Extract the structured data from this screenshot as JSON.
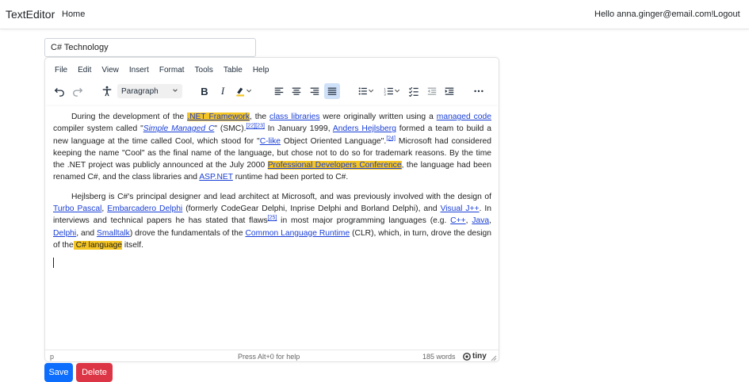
{
  "navbar": {
    "brand": "TextEditor",
    "home": "Home",
    "greeting": "Hello anna.ginger@email.com!",
    "logout": "Logout"
  },
  "document": {
    "title_value": "C# Technology"
  },
  "menubar": [
    "File",
    "Edit",
    "View",
    "Insert",
    "Format",
    "Tools",
    "Table",
    "Help"
  ],
  "toolbar": {
    "block_format": "Paragraph",
    "icons": [
      "undo-icon",
      "redo-icon",
      "accessibility-icon",
      "bold-icon",
      "italic-icon",
      "highlight-icon",
      "align-left-icon",
      "align-center-icon",
      "align-right-icon",
      "align-justify-icon",
      "bullet-list-icon",
      "numbered-list-icon",
      "checklist-icon",
      "outdent-icon",
      "indent-icon",
      "more-icon"
    ],
    "active_color": "#cfe1f8",
    "highlight_color": "#f5c523"
  },
  "content": {
    "p1": {
      "t1": "During the development of the ",
      "a1": ".NET Framework",
      "t2": ", the ",
      "a2": "class libraries",
      "t3": " were originally written using a ",
      "a3": "managed code",
      "t4": " compiler system called \"",
      "a4": "Simple Managed C",
      "t5": "\" (SMC).",
      "s1": "[22]",
      "s2": "[23]",
      "t6": " In January 1999, ",
      "a5": "Anders Hejlsberg",
      "t7": " formed a team to build a new language at the time called Cool, which stood for \"",
      "a6": "C-like",
      "t8": " Object Oriented Language\".",
      "s3": "[24]",
      "t9": " Microsoft had considered keeping the name \"Cool\" as the final name of the language, but chose not to do so for trademark reasons. By the time the .NET project was publicly announced at the July 2000 ",
      "a7": "Professional Developers Conference",
      "t10": ", the language had been renamed C#, and the class libraries and ",
      "a8": "ASP.NET",
      "t11": " runtime had been ported to C#."
    },
    "p2": {
      "t1": "Hejlsberg is C#'s principal designer and lead architect at Microsoft, and was previously involved with the design of ",
      "a1": "Turbo Pascal",
      "t2": ", ",
      "a2": "Embarcadero Delphi",
      "t3": " (formerly CodeGear Delphi, Inprise Delphi and Borland Delphi), and ",
      "a3": "Visual J++",
      "t4": ". In interviews and technical papers he has stated that flaws",
      "s1": "[25]",
      "t5": " in most major programming languages (e.g. ",
      "a4": "C++",
      "t6": ", ",
      "a5": "Java",
      "t7": ", ",
      "a6": "Delphi",
      "t8": ", and ",
      "a7": "Smalltalk",
      "t9": ") drove the fundamentals of the ",
      "a8": "Common Language Runtime",
      "t10": " (CLR), which, in turn, drove the design of the",
      "h1": " C# language",
      "t11": " itself."
    }
  },
  "statusbar": {
    "path": "p",
    "help": "Press Alt+0 for help",
    "words": "185 words",
    "brand": "tiny"
  },
  "actions": {
    "save": "Save",
    "delete": "Delete"
  }
}
